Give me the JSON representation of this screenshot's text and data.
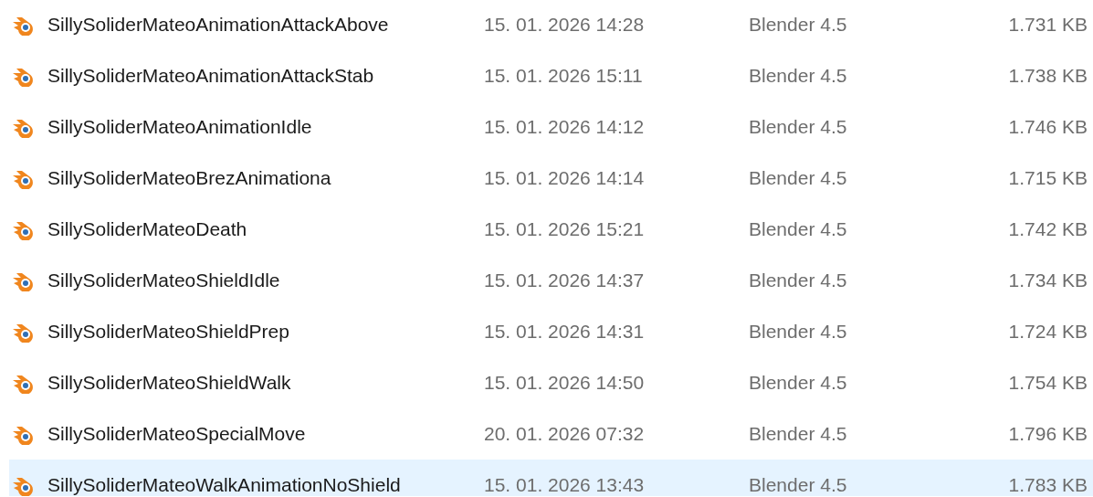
{
  "files": [
    {
      "name": "SillySoliderMateoAnimationAttackAbove",
      "modified": "15. 01. 2026 14:28",
      "type": "Blender 4.5",
      "size": "1.731 KB",
      "selected": false
    },
    {
      "name": "SillySoliderMateoAnimationAttackStab",
      "modified": "15. 01. 2026 15:11",
      "type": "Blender 4.5",
      "size": "1.738 KB",
      "selected": false
    },
    {
      "name": "SillySoliderMateoAnimationIdle",
      "modified": "15. 01. 2026 14:12",
      "type": "Blender 4.5",
      "size": "1.746 KB",
      "selected": false
    },
    {
      "name": "SillySoliderMateoBrezAnimationa",
      "modified": "15. 01. 2026 14:14",
      "type": "Blender 4.5",
      "size": "1.715 KB",
      "selected": false
    },
    {
      "name": "SillySoliderMateoDeath",
      "modified": "15. 01. 2026 15:21",
      "type": "Blender 4.5",
      "size": "1.742 KB",
      "selected": false
    },
    {
      "name": "SillySoliderMateoShieldIdle",
      "modified": "15. 01. 2026 14:37",
      "type": "Blender 4.5",
      "size": "1.734 KB",
      "selected": false
    },
    {
      "name": "SillySoliderMateoShieldPrep",
      "modified": "15. 01. 2026 14:31",
      "type": "Blender 4.5",
      "size": "1.724 KB",
      "selected": false
    },
    {
      "name": "SillySoliderMateoShieldWalk",
      "modified": "15. 01. 2026 14:50",
      "type": "Blender 4.5",
      "size": "1.754 KB",
      "selected": false
    },
    {
      "name": "SillySoliderMateoSpecialMove",
      "modified": "20. 01. 2026 07:32",
      "type": "Blender 4.5",
      "size": "1.796 KB",
      "selected": false
    },
    {
      "name": "SillySoliderMateoWalkAnimationNoShield",
      "modified": "15. 01. 2026 13:43",
      "type": "Blender 4.5",
      "size": "1.783 KB",
      "selected": true
    }
  ]
}
